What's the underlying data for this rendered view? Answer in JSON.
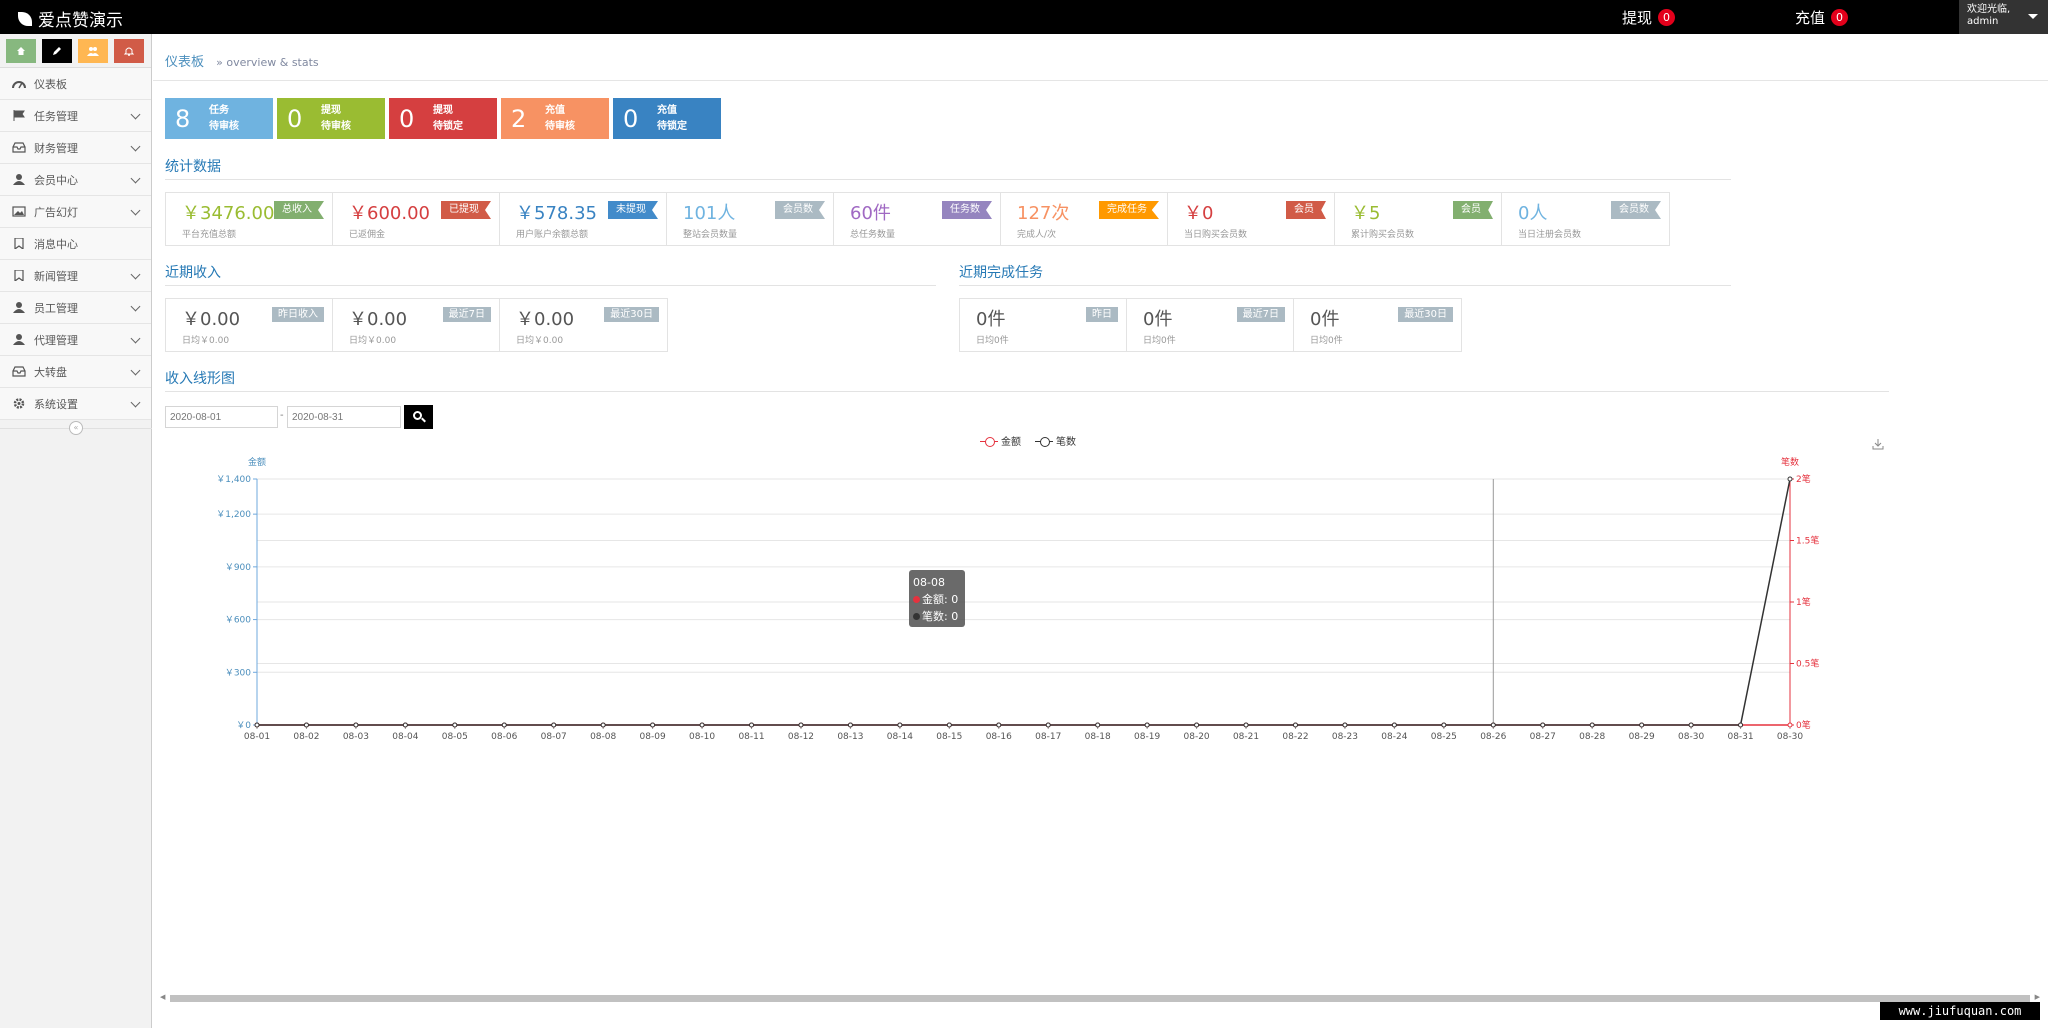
{
  "navbar": {
    "brand": "爱点赞演示",
    "withdraw_label": "提现",
    "withdraw_count": "0",
    "recharge_label": "充值",
    "recharge_count": "0",
    "welcome": "欢迎光临,",
    "username": "admin"
  },
  "sidebar": {
    "shortcuts": [
      "home-icon",
      "pencil-icon",
      "users-icon",
      "bell-icon"
    ],
    "items": [
      {
        "label": "仪表板",
        "icon": "dashboard-icon",
        "has_sub": false
      },
      {
        "label": "任务管理",
        "icon": "flag-icon",
        "has_sub": true
      },
      {
        "label": "财务管理",
        "icon": "inbox-icon",
        "has_sub": true
      },
      {
        "label": "会员中心",
        "icon": "user-icon",
        "has_sub": true
      },
      {
        "label": "广告幻灯",
        "icon": "picture-icon",
        "has_sub": true
      },
      {
        "label": "消息中心",
        "icon": "bookmark-icon",
        "has_sub": false
      },
      {
        "label": "新闻管理",
        "icon": "bookmark-icon",
        "has_sub": true
      },
      {
        "label": "员工管理",
        "icon": "user-icon",
        "has_sub": true
      },
      {
        "label": "代理管理",
        "icon": "user-icon",
        "has_sub": true
      },
      {
        "label": "大转盘",
        "icon": "inbox-icon",
        "has_sub": true
      },
      {
        "label": "系统设置",
        "icon": "gear-icon",
        "has_sub": true
      }
    ]
  },
  "breadcrumb": {
    "home": "仪表板",
    "sub": "» overview & stats"
  },
  "tiles": [
    {
      "num": "8",
      "line1": "任务",
      "line2": "待审核",
      "color": "#6fb3e0"
    },
    {
      "num": "0",
      "line1": "提现",
      "line2": "待审核",
      "color": "#9abc32"
    },
    {
      "num": "0",
      "line1": "提现",
      "line2": "待锁定",
      "color": "#d53f40"
    },
    {
      "num": "2",
      "line1": "充值",
      "line2": "待审核",
      "color": "#f79263"
    },
    {
      "num": "0",
      "line1": "充值",
      "line2": "待锁定",
      "color": "#3983c2"
    }
  ],
  "stats": {
    "title": "统计数据",
    "items": [
      {
        "value": "￥3476.00",
        "label": "平台充值总额",
        "tag": "总收入",
        "value_color": "#9abc32",
        "tag_color": "#82af6f",
        "style": "ribbon"
      },
      {
        "value": "￥600.00",
        "label": "已返佣金",
        "tag": "已提现",
        "value_color": "#d53f40",
        "tag_color": "#d15b47",
        "style": "ribbon"
      },
      {
        "value": "￥578.35",
        "label": "用户账户余额总额",
        "tag": "未提现",
        "value_color": "#3983c2",
        "tag_color": "#428bca",
        "style": "ribbon"
      },
      {
        "value": "101人",
        "label": "整站会员数量",
        "tag": "会员数",
        "value_color": "#6fb3e0",
        "tag_color": "#abbac3",
        "style": "ribbon"
      },
      {
        "value": "60件",
        "label": "总任务数量",
        "tag": "任务数",
        "value_color": "#a069c3",
        "tag_color": "#9585bf",
        "style": "ribbon"
      },
      {
        "value": "127次",
        "label": "完成人/次",
        "tag": "完成任务",
        "value_color": "#f79263",
        "tag_color": "#ff9900",
        "style": "ribbon"
      },
      {
        "value": "￥0",
        "label": "当日购买会员数",
        "tag": "会员",
        "value_color": "#d53f40",
        "tag_color": "#d15b47",
        "style": "ribbon"
      },
      {
        "value": "￥5",
        "label": "累计购买会员数",
        "tag": "会员",
        "value_color": "#9abc32",
        "tag_color": "#82af6f",
        "style": "ribbon"
      },
      {
        "value": "0人",
        "label": "当日注册会员数",
        "tag": "会员数",
        "value_color": "#6fb3e0",
        "tag_color": "#abbac3",
        "style": "ribbon"
      }
    ]
  },
  "income": {
    "title": "近期收入",
    "items": [
      {
        "value": "￥0.00",
        "label": "日均￥0.00",
        "tag": "昨日收入"
      },
      {
        "value": "￥0.00",
        "label": "日均￥0.00",
        "tag": "最近7日"
      },
      {
        "value": "￥0.00",
        "label": "日均￥0.00",
        "tag": "最近30日"
      }
    ]
  },
  "tasks": {
    "title": "近期完成任务",
    "items": [
      {
        "value": "0件",
        "label": "日均0件",
        "tag": "昨日"
      },
      {
        "value": "0件",
        "label": "日均0件",
        "tag": "最近7日"
      },
      {
        "value": "0件",
        "label": "日均0件",
        "tag": "最近30日"
      }
    ]
  },
  "chart_section": {
    "title": "收入线形图",
    "date_from": "2020-08-01",
    "date_sep": "-",
    "date_to": "2020-08-31"
  },
  "chart_data": {
    "type": "line",
    "legend_position": "top-center",
    "left_axis_name": "金额",
    "right_axis_name": "笔数",
    "x": [
      "08-01",
      "08-02",
      "08-03",
      "08-04",
      "08-05",
      "08-06",
      "08-07",
      "08-08",
      "08-09",
      "08-10",
      "08-11",
      "08-12",
      "08-13",
      "08-14",
      "08-15",
      "08-16",
      "08-17",
      "08-18",
      "08-19",
      "08-20",
      "08-21",
      "08-22",
      "08-23",
      "08-24",
      "08-25",
      "08-26",
      "08-27",
      "08-28",
      "08-29",
      "08-30",
      "08-31",
      "08-30"
    ],
    "left_ticks": [
      "￥0",
      "￥300",
      "￥600",
      "￥900",
      "￥1,200",
      "￥1,400"
    ],
    "left_tick_values": [
      0,
      300,
      600,
      900,
      1200,
      1400
    ],
    "ylim_left": [
      0,
      1400
    ],
    "right_ticks": [
      "0笔",
      "0.5笔",
      "1笔",
      "1.5笔",
      "2笔"
    ],
    "right_tick_values": [
      0,
      0.5,
      1,
      1.5,
      2
    ],
    "ylim_right": [
      0,
      2
    ],
    "grid": true,
    "series": [
      {
        "name": "金额",
        "color": "#e5323e",
        "axis": "left",
        "values": [
          0,
          0,
          0,
          0,
          0,
          0,
          0,
          0,
          0,
          0,
          0,
          0,
          0,
          0,
          0,
          0,
          0,
          0,
          0,
          0,
          0,
          0,
          0,
          0,
          0,
          0,
          0,
          0,
          0,
          0,
          0,
          0
        ]
      },
      {
        "name": "笔数",
        "color": "#333333",
        "axis": "right",
        "values": [
          0,
          0,
          0,
          0,
          0,
          0,
          0,
          0,
          0,
          0,
          0,
          0,
          0,
          0,
          0,
          0,
          0,
          0,
          0,
          0,
          0,
          0,
          0,
          0,
          0,
          0,
          0,
          0,
          0,
          0,
          0,
          2
        ]
      }
    ],
    "tooltip": {
      "title": "08-08",
      "row1": "金额: 0",
      "row2": "笔数: 0"
    },
    "crosshair_category": "08-26"
  },
  "watermark": "www.jiufuquan.com"
}
